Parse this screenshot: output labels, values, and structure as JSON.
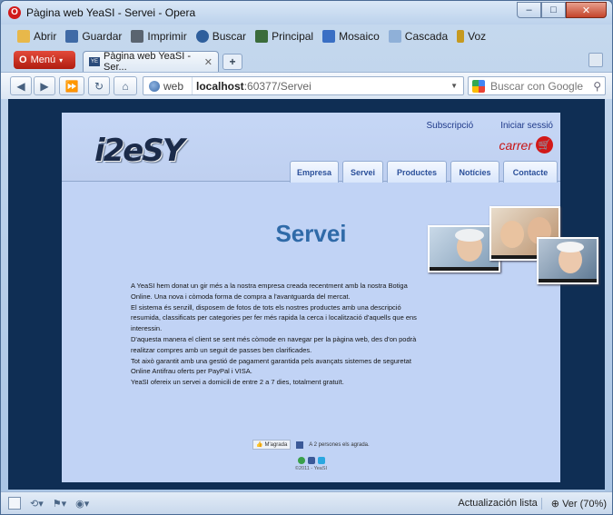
{
  "window": {
    "title": "Pàgina web YeaSI - Servei - Opera",
    "minimize": "–",
    "maximize": "□",
    "close": "✕"
  },
  "toolbar": {
    "open": "Abrir",
    "save": "Guardar",
    "print": "Imprimir",
    "find": "Buscar",
    "home": "Principal",
    "tile": "Mosaico",
    "cascade": "Cascada",
    "voice": "Voz"
  },
  "tabs": {
    "menu": "Menú",
    "active_tab": "Pàgina web YeaSI - Ser...",
    "favicon_text": "YE",
    "close_tab": "✕",
    "new_tab": "+"
  },
  "address": {
    "web_chip": "web",
    "host": "localhost",
    "path": ":60377/Servei",
    "search_placeholder": "Buscar con Google"
  },
  "site": {
    "logo": "i2eSY",
    "subscribe": "Subscripció",
    "login": "Iniciar sessió",
    "brand": "carrer",
    "nav": [
      "Empresa",
      "Servei",
      "Productes",
      "Notícies",
      "Contacte"
    ],
    "title": "Servei",
    "paragraphs": [
      "A YeaSI hem donat un gir més a la nostra empresa creada recentment amb la nostra Botiga Online. Una nova i còmoda forma de compra a l'avantguarda del mercat.",
      "El sistema és senzill, disposem de fotos de tots els nostres productes amb una descripció resumida, classificats per categories per fer més rapida la cerca i localització d'aquells que ens interessin.",
      "D'aquesta manera el client se sent més còmode en navegar per la pàgina web, des d'on podrà realitzar compres amb un seguit de passes ben clarificades.",
      "Tot això garantit amb una gestió de pagament garantida pels avançats sistemes de seguretat Online Antifrau oferts per PayPal i VISA.",
      "YeaSI ofereix un servei a domicili de entre 2 a 7 dies, totalment gratuït."
    ],
    "like_button": "M'agrada",
    "like_count": "A 2 persones els agrada.",
    "copyright": "©2011 - YeaSI"
  },
  "status": {
    "update": "Actualización lista",
    "zoom": "Ver (70%)"
  },
  "colors": {
    "page_bg": "#c1d3f5",
    "outer_bg": "#0f2e54",
    "title_blue": "#2f6aa8",
    "brand_red": "#c81414"
  }
}
